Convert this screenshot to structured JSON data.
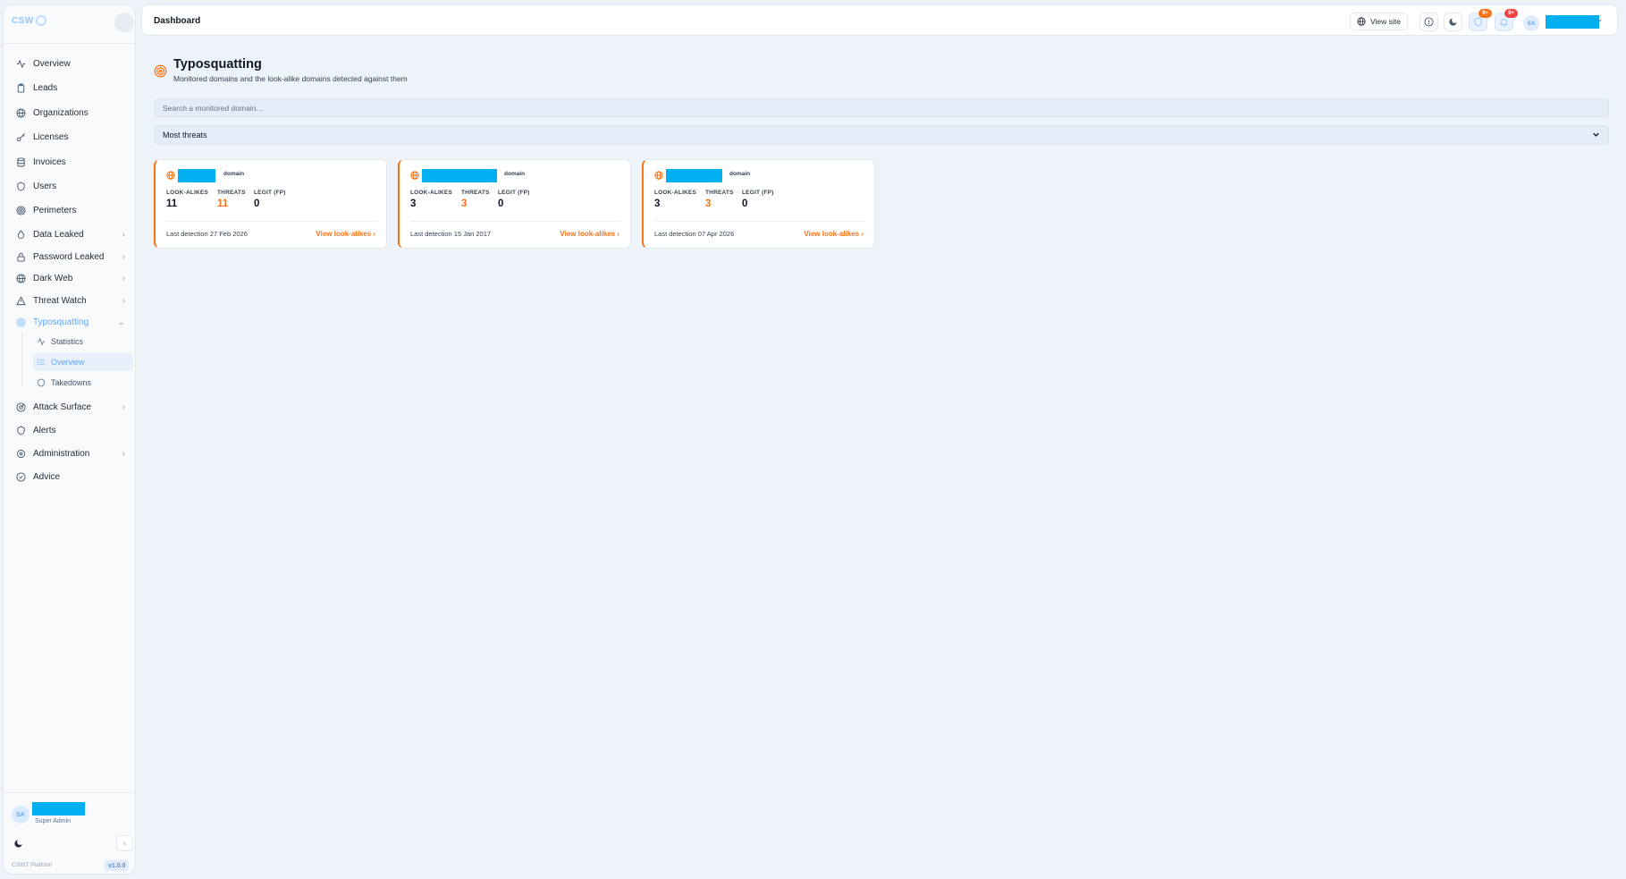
{
  "sidebar": {
    "brand": "CSW",
    "items": [
      {
        "label": "Overview",
        "icon": "activity-icon"
      },
      {
        "label": "Leads",
        "icon": "clipboard-icon"
      },
      {
        "label": "Organizations",
        "icon": "globe-icon"
      },
      {
        "label": "Licenses",
        "icon": "key-icon"
      },
      {
        "label": "Invoices",
        "icon": "database-icon"
      },
      {
        "label": "Users",
        "icon": "shield-icon"
      },
      {
        "label": "Perimeters",
        "icon": "target-icon"
      },
      {
        "label": "Data Leaked",
        "icon": "droplet-icon"
      },
      {
        "label": "Password Leaked",
        "icon": "lock-icon"
      },
      {
        "label": "Dark Web",
        "icon": "globe-icon"
      },
      {
        "label": "Threat Watch",
        "icon": "alert-triangle-icon"
      },
      {
        "label": "Typosquatting",
        "icon": "target-icon"
      },
      {
        "label": "Attack Surface",
        "icon": "radar-icon"
      },
      {
        "label": "Alerts",
        "icon": "shield-icon"
      },
      {
        "label": "Administration",
        "icon": "cog-icon"
      },
      {
        "label": "Advice",
        "icon": "check-circle-icon"
      }
    ],
    "sub_items": [
      {
        "label": "Statistics",
        "icon": "activity-icon"
      },
      {
        "label": "Overview",
        "icon": "list-icon"
      },
      {
        "label": "Takedowns",
        "icon": "shield-icon"
      }
    ],
    "user": {
      "initials": "SA",
      "role": "Super Admin"
    },
    "platform": "CSINT Platform",
    "version": "v1.0.0"
  },
  "header": {
    "title": "Dashboard",
    "view_site_label": "View site",
    "badge_1": "9+",
    "badge_2": "9+",
    "user_initials": "SA"
  },
  "page": {
    "title": "Typosquatting",
    "subtitle": "Monitored domains and the look-alike domains detected against them",
    "search_placeholder": "Search a monitored domain...",
    "sort_value": "Most threats"
  },
  "cards": [
    {
      "tag": "domain",
      "lookalikes_label": "LOOK-ALIKES",
      "lookalikes": "11",
      "threats_label": "THREATS",
      "threats": "11",
      "legit_label": "LEGIT (FP)",
      "legit": "0",
      "last_detection": "Last detection 27 Feb 2026",
      "link": "View look-alikes"
    },
    {
      "tag": "domain",
      "lookalikes_label": "LOOK-ALIKES",
      "lookalikes": "3",
      "threats_label": "THREATS",
      "threats": "3",
      "legit_label": "LEGIT (FP)",
      "legit": "0",
      "last_detection": "Last detection 15 Jan 2017",
      "link": "View look-alikes"
    },
    {
      "tag": "domain",
      "lookalikes_label": "LOOK-ALIKES",
      "lookalikes": "3",
      "threats_label": "THREATS",
      "threats": "3",
      "legit_label": "LEGIT (FP)",
      "legit": "0",
      "last_detection": "Last detection 07 Apr 2026",
      "link": "View look-alikes"
    }
  ],
  "colors": {
    "accent": "#f97316",
    "primary": "#60a5fa",
    "redaction": "#00b0f0",
    "background": "#eef3f9"
  }
}
